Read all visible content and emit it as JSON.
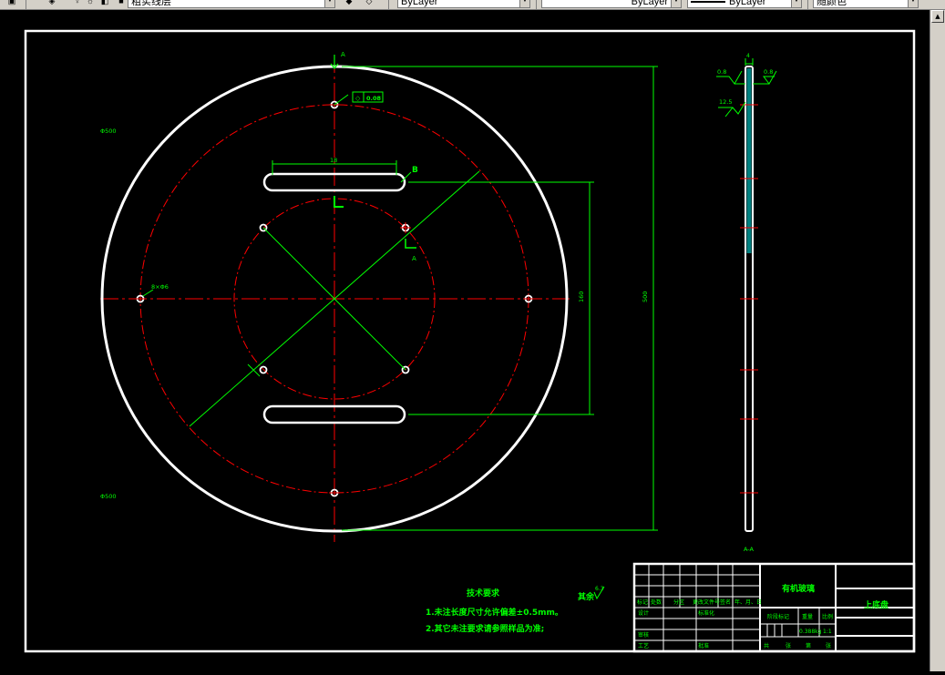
{
  "toolbar": {
    "layer_name": "粗实线层",
    "color": "ByLayer",
    "linetype": "ByLayer",
    "lineweight": "ByLayer",
    "plotstyle": "随颜色"
  },
  "drawing": {
    "section_marker_top": "A",
    "section_marker_right": "A",
    "flatness_value": "0.08",
    "diameter_label_top_left": "Φ500",
    "diameter_label_bottom_left": "Φ500",
    "hole_label": "8×Φ6",
    "slot_width_dim": "18",
    "slot_spacing_dim": "160",
    "outer_height_dim": "500",
    "slot_callout": "B",
    "section_view_label": "A-A",
    "thickness_dim": "4",
    "roughness_top_left": "0.8",
    "roughness_top_right": "0.8",
    "roughness_side": "12.5",
    "remaining_roughness_label": "其余",
    "remaining_roughness_value": "6.3"
  },
  "notes": {
    "heading": "技术要求",
    "line1": "1.未注长度尺寸允许偏差±0.5mm。",
    "line2": "2.其它未注要求请参照样品为准;"
  },
  "title_block": {
    "material": "有机玻璃",
    "part_name": "上底盘",
    "row_labels": [
      "标记",
      "处数",
      "分区",
      "更改文件号",
      "签名",
      "年、月、日"
    ],
    "designer": "设计",
    "standardization": "标准化",
    "checker": "审核",
    "process": "工艺",
    "approve": "批准",
    "stage_mark": "阶段标记",
    "weight_header": "重量",
    "scale_header": "比例",
    "weight_value": "0.388kg",
    "scale_value": "1:1",
    "sheets_total": "共",
    "sheets_label": "张",
    "sheet_of": "第",
    "sheet_label": "张"
  },
  "colors": {
    "outline": "#ffffff",
    "dimension": "#00ff00",
    "centerline": "#ff0000",
    "hatch": "#00ffff"
  }
}
